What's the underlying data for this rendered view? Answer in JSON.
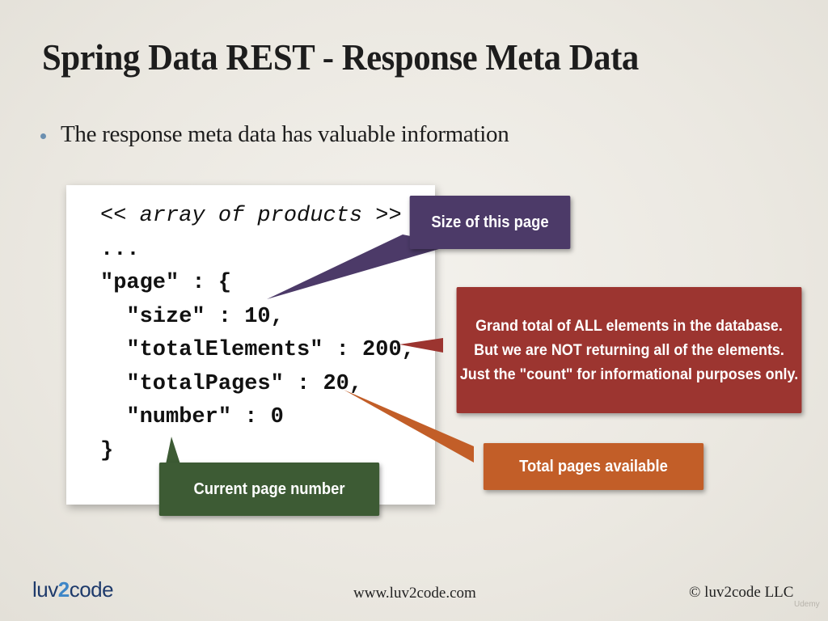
{
  "slide": {
    "title": "Spring Data REST - Response Meta Data",
    "bullet": "The response meta data has valuable information"
  },
  "code": {
    "lines": [
      "<< array of products >>",
      "...",
      "\"page\" : {",
      "  \"size\" : 10,",
      "  \"totalElements\" : 200,",
      "  \"totalPages\" : 20,",
      "  \"number\" : 0",
      "}"
    ]
  },
  "callouts": {
    "size": "Size of this page",
    "total_line1": "Grand total of ALL elements in the database.",
    "total_line2": "But we are NOT returning all of the elements.",
    "total_line3": "Just the \"count\" for informational purposes only.",
    "pages": "Total pages available",
    "current": "Current page number"
  },
  "colors": {
    "size_callout": "#4c3a68",
    "total_callout": "#9c3530",
    "pages_callout": "#c25e28",
    "current_callout": "#3d5b34"
  },
  "footer": {
    "logo_left": "luv",
    "logo_two": "2",
    "logo_right": "code",
    "url": "www.luv2code.com",
    "copyright": "© luv2code LLC",
    "watermark": "Udemy"
  }
}
